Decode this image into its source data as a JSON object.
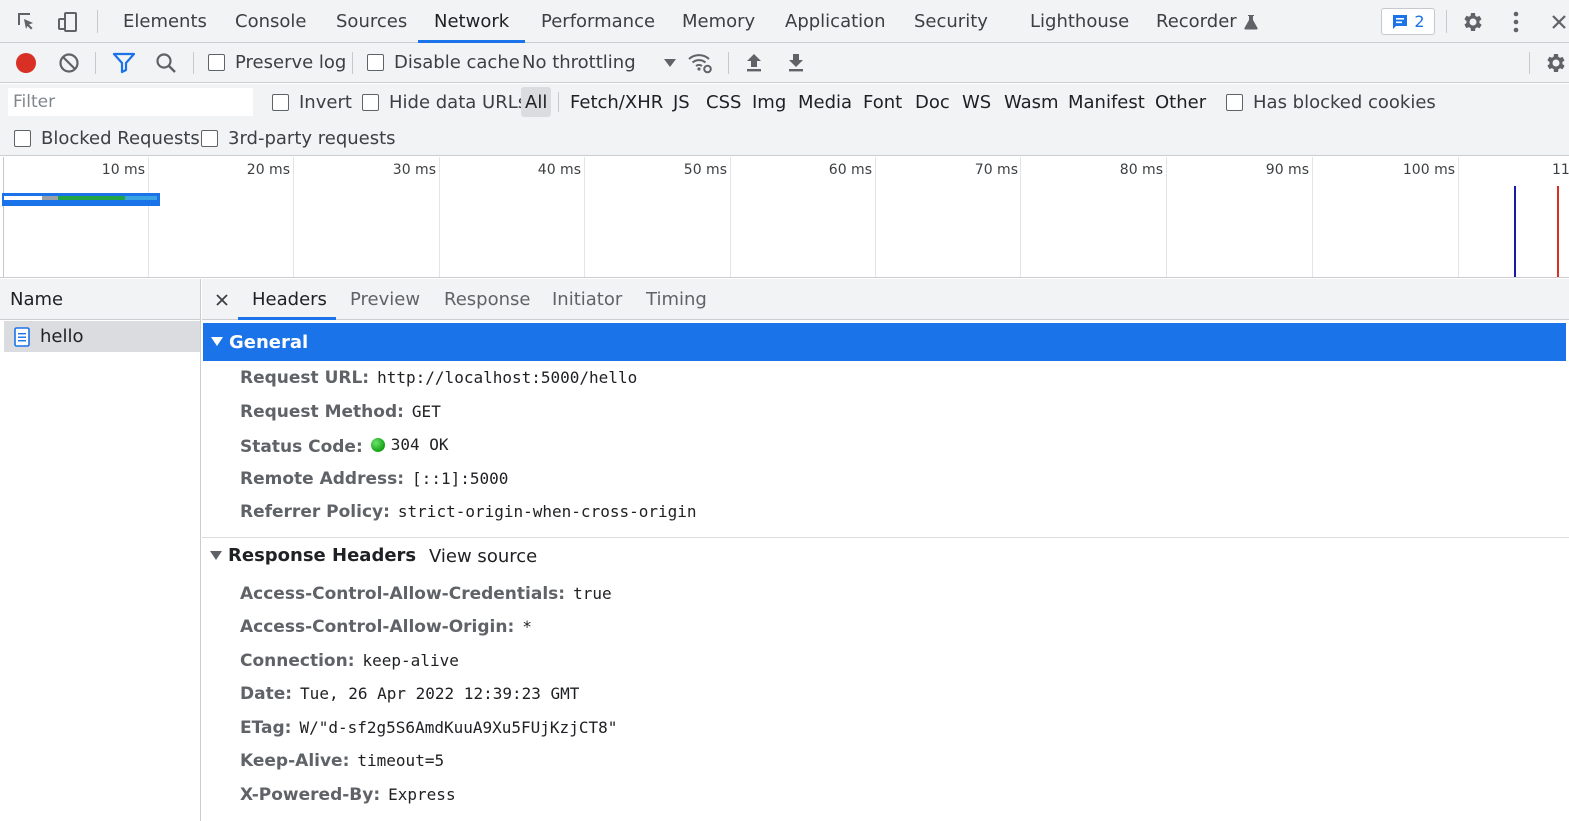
{
  "tabs": [
    {
      "label": "Elements"
    },
    {
      "label": "Console"
    },
    {
      "label": "Sources"
    },
    {
      "label": "Network"
    },
    {
      "label": "Performance"
    },
    {
      "label": "Memory"
    },
    {
      "label": "Application"
    },
    {
      "label": "Security"
    },
    {
      "label": "Lighthouse"
    },
    {
      "label": "Recorder"
    }
  ],
  "active_tab": "Network",
  "issues_count": "2",
  "toolbar": {
    "preserve_log": "Preserve log",
    "disable_cache": "Disable cache",
    "throttling": "No throttling"
  },
  "filter": {
    "placeholder": "Filter",
    "invert": "Invert",
    "hide_data_urls": "Hide data URLs",
    "types": [
      "All",
      "Fetch/XHR",
      "JS",
      "CSS",
      "Img",
      "Media",
      "Font",
      "Doc",
      "WS",
      "Wasm",
      "Manifest",
      "Other"
    ],
    "selected_type": "All",
    "has_blocked_cookies": "Has blocked cookies",
    "blocked_requests": "Blocked Requests",
    "third_party": "3rd-party requests"
  },
  "overview": {
    "ticks": [
      "10 ms",
      "20 ms",
      "30 ms",
      "40 ms",
      "50 ms",
      "60 ms",
      "70 ms",
      "80 ms",
      "90 ms",
      "100 ms",
      "11"
    ]
  },
  "requests": {
    "column_name": "Name",
    "items": [
      {
        "name": "hello"
      }
    ]
  },
  "detail_tabs": [
    "Headers",
    "Preview",
    "Response",
    "Initiator",
    "Timing"
  ],
  "active_detail_tab": "Headers",
  "general": {
    "title": "General",
    "rows": [
      {
        "key": "Request URL:",
        "value": "http://localhost:5000/hello"
      },
      {
        "key": "Request Method:",
        "value": "GET"
      },
      {
        "key": "Status Code:",
        "value": "304 OK"
      },
      {
        "key": "Remote Address:",
        "value": "[::1]:5000"
      },
      {
        "key": "Referrer Policy:",
        "value": "strict-origin-when-cross-origin"
      }
    ]
  },
  "response_headers": {
    "title": "Response Headers",
    "view_source": "View source",
    "rows": [
      {
        "key": "Access-Control-Allow-Credentials:",
        "value": "true"
      },
      {
        "key": "Access-Control-Allow-Origin:",
        "value": "*"
      },
      {
        "key": "Connection:",
        "value": "keep-alive"
      },
      {
        "key": "Date:",
        "value": "Tue, 26 Apr 2022 12:39:23 GMT"
      },
      {
        "key": "ETag:",
        "value": "W/\"d-sf2g5S6AmdKuuA9Xu5FUjKzjCT8\""
      },
      {
        "key": "Keep-Alive:",
        "value": "timeout=5"
      },
      {
        "key": "X-Powered-By:",
        "value": "Express"
      }
    ]
  },
  "colors": {
    "accent": "#1a73e8",
    "record_red": "#d93025",
    "status_green": "#1ea446",
    "dom_content_loaded_line": "#1a1aa6",
    "load_line": "#d93025"
  }
}
